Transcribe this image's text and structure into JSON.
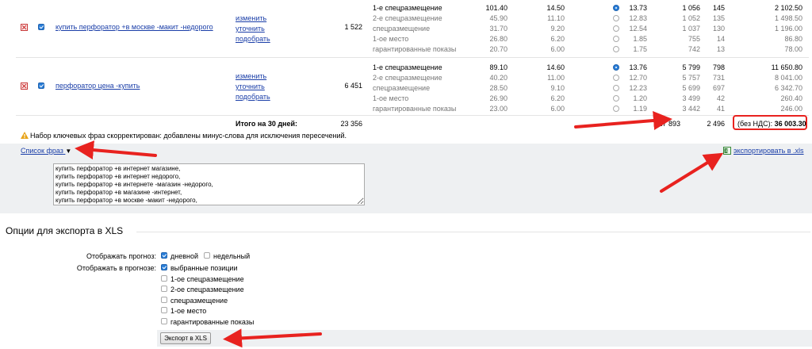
{
  "keywords": [
    {
      "phrase": "купить перфоратор +в москве -макит -недорого",
      "actions": [
        "изменить",
        "уточнить",
        "подобрать"
      ],
      "impressions": "1 522",
      "positions": [
        {
          "name": "1-е спецразмещение",
          "bid": "101.40",
          "price": "14.50",
          "cpc": "13.73",
          "clicks": "1 056",
          "ctr": "145",
          "cost": "2 102.50",
          "selected": true
        },
        {
          "name": "2-е спецразмещение",
          "bid": "45.90",
          "price": "11.10",
          "cpc": "12.83",
          "clicks": "1 052",
          "ctr": "135",
          "cost": "1 498.50",
          "selected": false
        },
        {
          "name": "спецразмещение",
          "bid": "31.70",
          "price": "9.20",
          "cpc": "12.54",
          "clicks": "1 037",
          "ctr": "130",
          "cost": "1 196.00",
          "selected": false
        },
        {
          "name": "1-ое место",
          "bid": "26.80",
          "price": "6.20",
          "cpc": "1.85",
          "clicks": "755",
          "ctr": "14",
          "cost": "86.80",
          "selected": false
        },
        {
          "name": "гарантированные показы",
          "bid": "20.70",
          "price": "6.00",
          "cpc": "1.75",
          "clicks": "742",
          "ctr": "13",
          "cost": "78.00",
          "selected": false
        }
      ]
    },
    {
      "phrase": "перфоратор цена -купить",
      "actions": [
        "изменить",
        "уточнить",
        "подобрать"
      ],
      "impressions": "6 451",
      "positions": [
        {
          "name": "1-е спецразмещение",
          "bid": "89.10",
          "price": "14.60",
          "cpc": "13.76",
          "clicks": "5 799",
          "ctr": "798",
          "cost": "11 650.80",
          "selected": true
        },
        {
          "name": "2-е спецразмещение",
          "bid": "40.20",
          "price": "11.00",
          "cpc": "12.70",
          "clicks": "5 757",
          "ctr": "731",
          "cost": "8 041.00",
          "selected": false
        },
        {
          "name": "спецразмещение",
          "bid": "28.50",
          "price": "9.10",
          "cpc": "12.23",
          "clicks": "5 699",
          "ctr": "697",
          "cost": "6 342.70",
          "selected": false
        },
        {
          "name": "1-ое место",
          "bid": "26.90",
          "price": "6.20",
          "cpc": "1.20",
          "clicks": "3 499",
          "ctr": "42",
          "cost": "260.40",
          "selected": false
        },
        {
          "name": "гарантированные показы",
          "bid": "23.00",
          "price": "6.00",
          "cpc": "1.19",
          "clicks": "3 442",
          "ctr": "41",
          "cost": "246.00",
          "selected": false
        }
      ]
    }
  ],
  "totals": {
    "label": "Итого на 30 дней:",
    "impressions": "23 356",
    "clicks": "17 893",
    "ctr": "2 496",
    "cost_label": "(без НДС):",
    "cost_value": "36 003.30"
  },
  "warning": "Набор ключевых фраз скорректирован: добавлены минус-слова для исключения пересечений.",
  "phrase_list": {
    "toggle_label": "Список фраз",
    "text": "купить перфоратор +в интернет магазине,\nкупить перфоратор +в интернет недорого,\nкупить перфоратор +в интернете -магазин -недорого,\nкупить перфоратор +в магазине -интернет,\nкупить перфоратор +в москве -макит -недорого,"
  },
  "export_link": "экспортировать в .xls",
  "export_options": {
    "title": "Опции для экспорта в XLS",
    "forecast_label": "Отображать прогноз:",
    "forecast_daily": "дневной",
    "forecast_weekly": "недельный",
    "in_forecast_label": "Отображать в прогнозе:",
    "options": [
      {
        "label": "выбранные позиции",
        "checked": true
      },
      {
        "label": "1-ое спецразмещение",
        "checked": false
      },
      {
        "label": "2-ое спецразмещение",
        "checked": false
      },
      {
        "label": "спецразмещение",
        "checked": false
      },
      {
        "label": "1-ое место",
        "checked": false
      },
      {
        "label": "гарантированные показы",
        "checked": false
      }
    ],
    "button": "Экспорт в XLS"
  },
  "colors": {
    "link": "#1a3ea8",
    "arrow": "#e8221f",
    "highlight": "#e8221f",
    "panel": "#eef0f2"
  }
}
